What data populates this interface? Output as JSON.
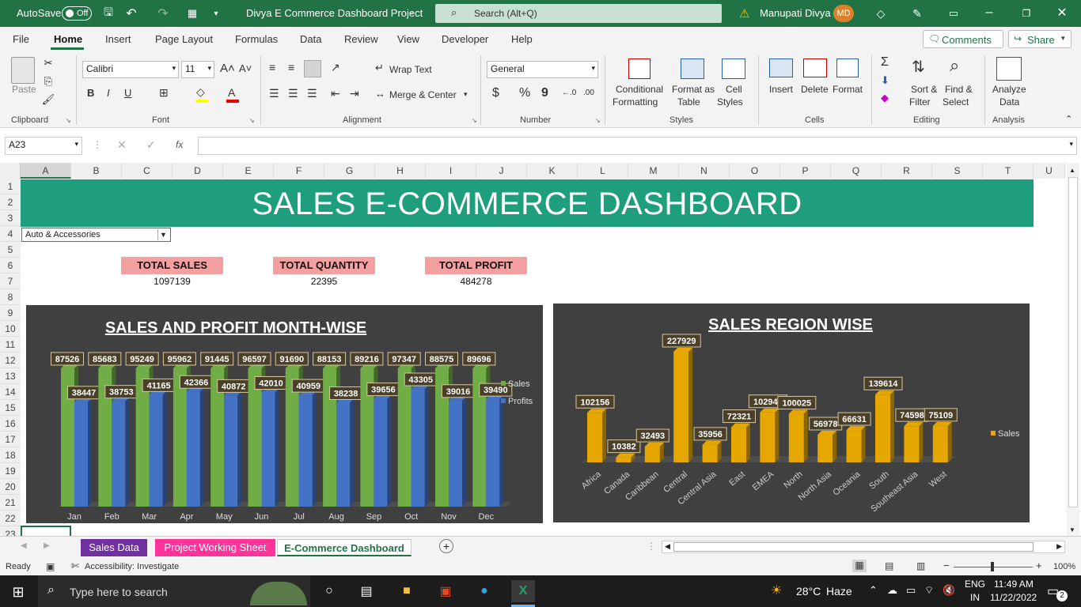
{
  "titlebar": {
    "autosave_label": "AutoSave",
    "autosave_state": "Off",
    "doc_title": "Divya E Commerce Dashboard Project",
    "search_placeholder": "Search (Alt+Q)",
    "user_name": "Manupati Divya",
    "user_initials": "MD"
  },
  "menu": [
    "File",
    "Home",
    "Insert",
    "Page Layout",
    "Formulas",
    "Data",
    "Review",
    "View",
    "Developer",
    "Help"
  ],
  "menu_active": "Home",
  "menu_right": {
    "comments": "Comments",
    "share": "Share"
  },
  "ribbon": {
    "clipboard": {
      "paste": "Paste",
      "group": "Clipboard"
    },
    "font": {
      "name": "Calibri",
      "size": "11",
      "group": "Font"
    },
    "alignment": {
      "wrap": "Wrap Text",
      "merge": "Merge & Center",
      "group": "Alignment"
    },
    "number": {
      "format": "General",
      "group": "Number"
    },
    "styles": {
      "cond1": "Conditional",
      "cond2": "Formatting",
      "fmt1": "Format as",
      "fmt2": "Table",
      "cell1": "Cell",
      "cell2": "Styles",
      "group": "Styles"
    },
    "cells": {
      "insert": "Insert",
      "delete": "Delete",
      "format": "Format",
      "group": "Cells"
    },
    "editing": {
      "sort1": "Sort &",
      "sort2": "Filter",
      "find1": "Find &",
      "find2": "Select",
      "group": "Editing"
    },
    "analysis": {
      "a1": "Analyze",
      "a2": "Data",
      "group": "Analysis"
    }
  },
  "formula_bar": {
    "name_box": "A23",
    "fx": "fx",
    "formula": ""
  },
  "columns": [
    "A",
    "B",
    "C",
    "D",
    "E",
    "F",
    "G",
    "H",
    "I",
    "J",
    "K",
    "L",
    "M",
    "N",
    "O",
    "P",
    "Q",
    "R",
    "S",
    "T",
    "U"
  ],
  "rows": [
    "1",
    "2",
    "3",
    "4",
    "5",
    "6",
    "7",
    "8",
    "9",
    "10",
    "11",
    "12",
    "13",
    "14",
    "15",
    "16",
    "17",
    "18",
    "19",
    "20",
    "21",
    "22",
    "23"
  ],
  "dashboard": {
    "title": "SALES E-COMMERCE DASHBOARD",
    "dropdown_value": "Auto & Accessories",
    "kpis": [
      {
        "label": "TOTAL SALES",
        "value": "1097139"
      },
      {
        "label": "TOTAL QUANTITY",
        "value": "22395"
      },
      {
        "label": "TOTAL PROFIT",
        "value": "484278"
      }
    ]
  },
  "chart_data": [
    {
      "type": "bar",
      "title": "SALES AND PROFIT MONTH-WISE",
      "categories": [
        "Jan",
        "Feb",
        "Mar",
        "Apr",
        "May",
        "Jun",
        "Jul",
        "Aug",
        "Sep",
        "Oct",
        "Nov",
        "Dec"
      ],
      "series": [
        {
          "name": "Sales",
          "color": "#70ad47",
          "values": [
            87526,
            85683,
            95249,
            95962,
            91445,
            96597,
            91690,
            88153,
            89216,
            97347,
            88575,
            89696
          ]
        },
        {
          "name": "Profits",
          "color": "#4472c4",
          "values": [
            38447,
            38753,
            41165,
            42366,
            40872,
            42010,
            40959,
            38238,
            39656,
            43305,
            39016,
            39490
          ]
        }
      ],
      "legend": "right",
      "ylim": [
        0,
        100000
      ],
      "grid": false
    },
    {
      "type": "bar",
      "title": "SALES REGION WISE",
      "categories": [
        "Africa",
        "Canada",
        "Caribbean",
        "Central",
        "Central Asia",
        "East",
        "EMEA",
        "North",
        "North Asia",
        "Oceania",
        "South",
        "Southeast Asia",
        "West"
      ],
      "series": [
        {
          "name": "Sales",
          "color": "#e6a800",
          "values": [
            102156,
            10382,
            32493,
            227929,
            35956,
            72321,
            102947,
            100025,
            56978,
            66631,
            139614,
            74598,
            75109
          ]
        }
      ],
      "legend": "right",
      "ylim": [
        0,
        240000
      ],
      "grid": false
    }
  ],
  "sheet_tabs": [
    {
      "label": "Sales Data",
      "bg": "#7030a0",
      "fg": "#ffffff"
    },
    {
      "label": "Project Working Sheet",
      "bg": "#ff3399",
      "fg": "#ffffff"
    },
    {
      "label": "E-Commerce Dashboard",
      "bg": "#ffffff",
      "fg": "#217346"
    }
  ],
  "status": {
    "ready": "Ready",
    "accessibility": "Accessibility: Investigate",
    "zoom": "100%"
  },
  "taskbar": {
    "search_placeholder": "Type here to search",
    "weather_temp": "28°C",
    "weather_desc": "Haze",
    "lang1": "ENG",
    "lang2": "IN",
    "time": "11:49 AM",
    "date": "11/22/2022",
    "notif": "2"
  }
}
